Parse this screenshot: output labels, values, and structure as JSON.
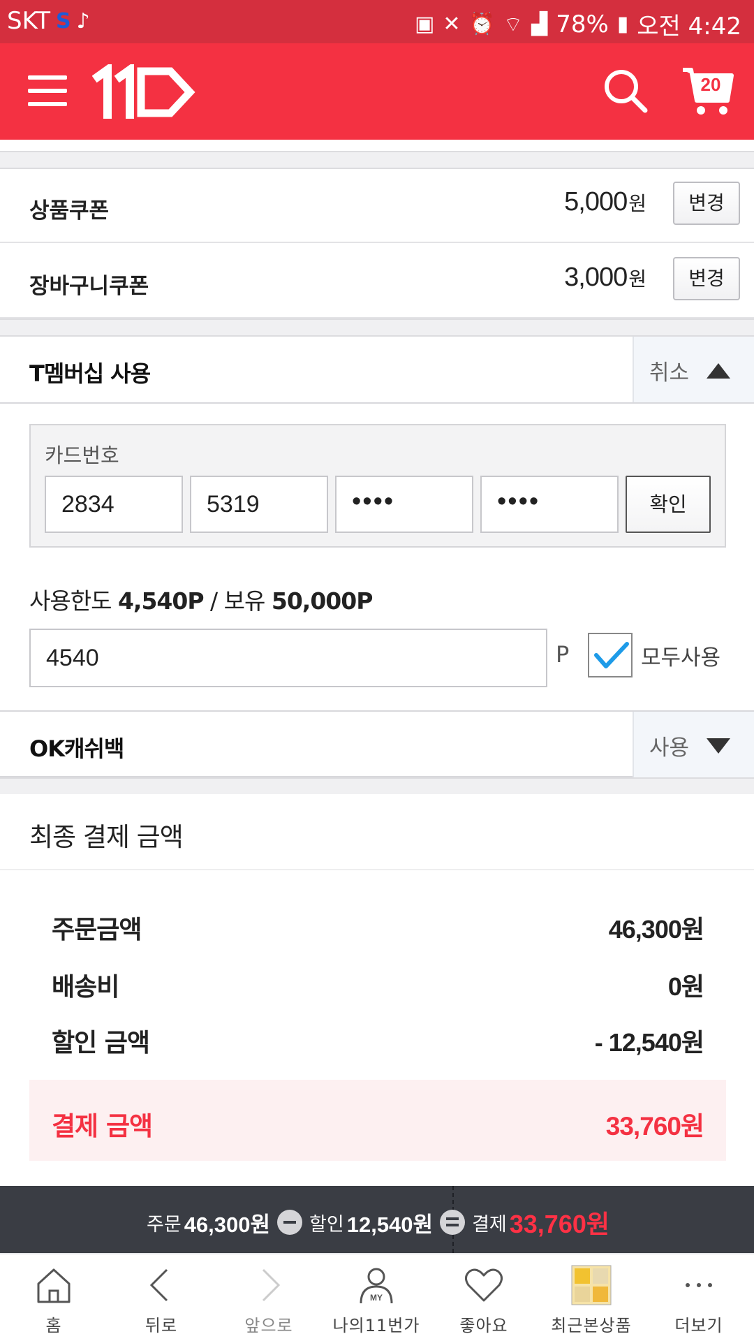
{
  "status_bar": {
    "carrier": "SKT",
    "battery": "78%",
    "time": "오전 4:42"
  },
  "header": {
    "logo": "11",
    "cart_count": "20"
  },
  "coupons": [
    {
      "label": "상품쿠폰",
      "amount": "5,000",
      "unit": "원",
      "button": "변경"
    },
    {
      "label": "장바구니쿠폰",
      "amount": "3,000",
      "unit": "원",
      "button": "변경"
    }
  ],
  "t_membership": {
    "title": "T멤버십 사용",
    "toggle_label": "취소",
    "card_caption": "카드번호",
    "card_fields": [
      "2834",
      "5319",
      "••••",
      "••••"
    ],
    "confirm_button": "확인",
    "limit_prefix": "사용한도",
    "limit_value": "4,540P",
    "limit_sep": "/ 보유",
    "owned_value": "50,000P",
    "point_value": "4540",
    "point_unit": "P",
    "use_all_label": "모두사용",
    "use_all_checked": true
  },
  "ok_cashbag": {
    "title": "OK캐쉬백",
    "toggle_label": "사용"
  },
  "final": {
    "title": "최종 결제 금액",
    "rows": [
      {
        "label": "주문금액",
        "value": "46,300원"
      },
      {
        "label": "배송비",
        "value": "0원"
      },
      {
        "label": "할인 금액",
        "value": "- 12,540원"
      }
    ],
    "pay_label": "결제 금액",
    "pay_value": "33,760원"
  },
  "summary_bar": {
    "order_label": "주문",
    "order_value": "46,300원",
    "discount_label": "할인",
    "discount_value": "12,540원",
    "pay_label": "결제",
    "pay_value": "33,760원"
  },
  "bottom_nav": [
    {
      "label": "홈"
    },
    {
      "label": "뒤로"
    },
    {
      "label": "앞으로"
    },
    {
      "label": "나의11번가"
    },
    {
      "label": "좋아요"
    },
    {
      "label": "최근본상품"
    },
    {
      "label": "더보기"
    }
  ],
  "colors": {
    "brand": "#f43142",
    "status_bar": "#d42f3e",
    "summary_bar": "#3a3d44",
    "check": "#1e9be8"
  }
}
